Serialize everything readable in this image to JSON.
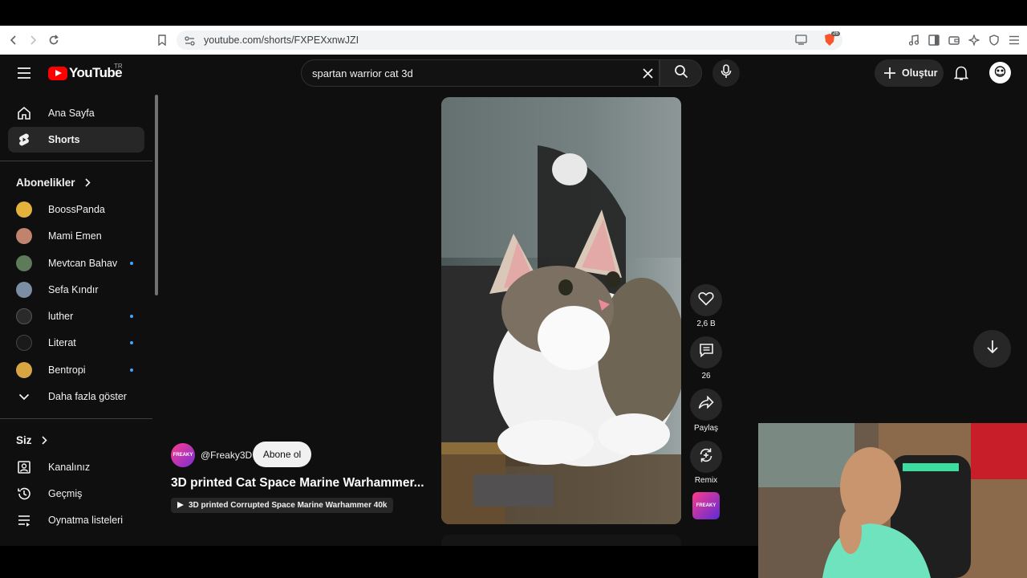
{
  "browser": {
    "url": "youtube.com/shorts/FXPEXxnwJZI",
    "shield_count": "26"
  },
  "header": {
    "logo_text": "YouTube",
    "country_code": "TR",
    "search_value": "spartan warrior cat 3d",
    "create_label": "Oluştur"
  },
  "sidebar": {
    "nav": [
      {
        "label": "Ana Sayfa",
        "icon": "home-icon"
      },
      {
        "label": "Shorts",
        "icon": "shorts-icon"
      }
    ],
    "subscriptions_title": "Abonelikler",
    "subscriptions": [
      {
        "label": "BoossPanda",
        "color": "#e2b23c",
        "new": false
      },
      {
        "label": "Mami Emen",
        "color": "#c0846e",
        "new": false
      },
      {
        "label": "Mevtcan Bahav",
        "color": "#5e7a5a",
        "new": true
      },
      {
        "label": "Sefa Kındır",
        "color": "#7c8ea3",
        "new": false
      },
      {
        "label": "luther",
        "color": "#2a2a2a",
        "new": true
      },
      {
        "label": "Literat",
        "color": "#1a1a1a",
        "new": true
      },
      {
        "label": "Bentropi",
        "color": "#d7a542",
        "new": true
      }
    ],
    "show_more": "Daha fazla göster",
    "you_title": "Siz",
    "you_items": [
      {
        "label": "Kanalınız",
        "icon": "channel-icon"
      },
      {
        "label": "Geçmiş",
        "icon": "history-icon"
      },
      {
        "label": "Oynatma listeleri",
        "icon": "playlist-icon"
      }
    ]
  },
  "short": {
    "channel_handle": "@Freaky3D",
    "channel_avatar_text": "FREAKY",
    "subscribe_label": "Abone ol",
    "title": "3D printed Cat Space Marine Warhammer...",
    "related_chip": "3D printed Corrupted Space Marine Warhammer 40k",
    "actions": {
      "likes": "2,6 B",
      "comments": "26",
      "share": "Paylaş",
      "remix": "Remix"
    }
  }
}
